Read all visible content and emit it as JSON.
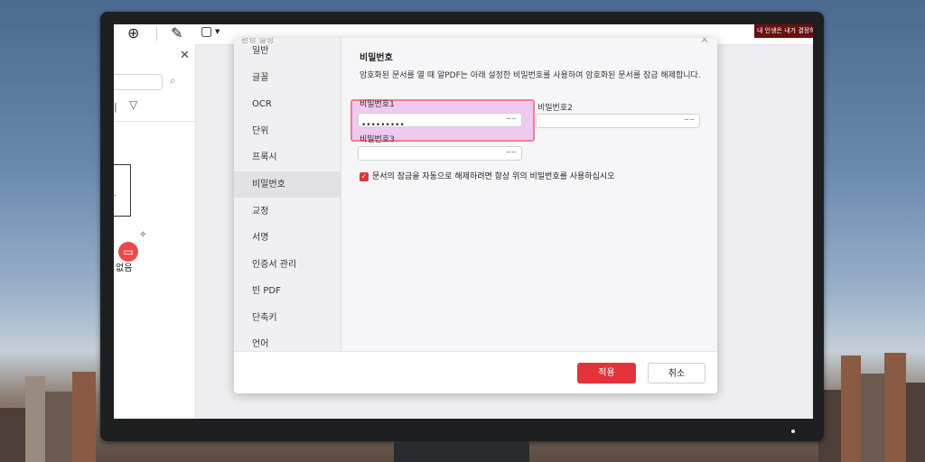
{
  "window": {
    "title": "환경 설정",
    "ad_text": "내 인생은 내가 결정하기"
  },
  "left_panel": {
    "no_items_text": "없음"
  },
  "nav": {
    "items": [
      {
        "label": "일반"
      },
      {
        "label": "글꼴"
      },
      {
        "label": "OCR"
      },
      {
        "label": "단위"
      },
      {
        "label": "프록시"
      },
      {
        "label": "비밀번호"
      },
      {
        "label": "교정"
      },
      {
        "label": "서명"
      },
      {
        "label": "인증서 관리"
      },
      {
        "label": "빈 PDF"
      },
      {
        "label": "단축키"
      },
      {
        "label": "언어"
      }
    ],
    "active": "비밀번호"
  },
  "password": {
    "section_title": "비밀번호",
    "description": "암호화된 문서를 열 때 알PDF는 아래 설정한 비밀번호를 사용하여 암호화된 문서를 잠금 해제합니다.",
    "field1_label": "비밀번호1",
    "field1_value": "•••••••••",
    "field2_label": "비밀번호2",
    "field2_value": "",
    "field3_label": "비밀번호3",
    "field3_value": "",
    "auto_unlock_label": "문서의 잠금을 자동으로 해제하려면 항상 위의 비밀번호를 사용하십시오",
    "auto_unlock_checked": true
  },
  "buttons": {
    "apply": "적용",
    "cancel": "취소"
  },
  "colors": {
    "accent": "#e2323a",
    "highlight_border": "#ee7f8d",
    "highlight_fill": "#ecb9ec"
  }
}
